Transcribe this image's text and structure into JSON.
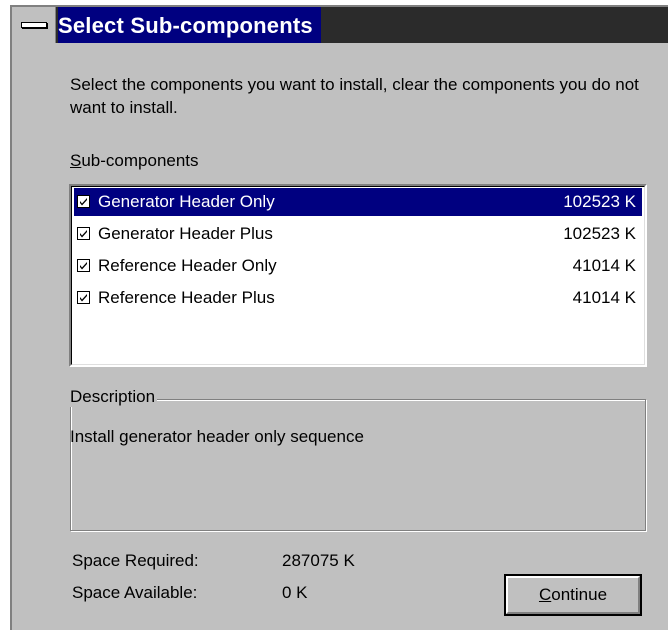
{
  "window": {
    "title": "Select Sub-components"
  },
  "intro_text": "Select the components you want to install, clear the components you do not want to install.",
  "subcomponents": {
    "label_mnemonic": "S",
    "label_rest": "ub-components",
    "items": [
      {
        "name": "Generator Header Only",
        "size": "102523 K",
        "checked": true,
        "selected": true
      },
      {
        "name": "Generator Header Plus",
        "size": "102523 K",
        "checked": true,
        "selected": false
      },
      {
        "name": "Reference Header Only",
        "size": "41014 K",
        "checked": true,
        "selected": false
      },
      {
        "name": "Reference Header Plus",
        "size": "41014 K",
        "checked": true,
        "selected": false
      }
    ]
  },
  "description": {
    "label": "Description",
    "text": "Install generator header only sequence"
  },
  "space": {
    "required_label": "Space Required:",
    "required_value": "287075 K",
    "available_label": "Space Available:",
    "available_value": "0 K"
  },
  "continue_button": {
    "mnemonic": "C",
    "rest": "ontinue"
  },
  "colors": {
    "dialog_bg": "#c0c0c0",
    "selection": "#000080",
    "titlebar": "#000080"
  },
  "icons": {
    "system_menu": "system-menu-icon",
    "checkbox": "checkmark-icon"
  }
}
